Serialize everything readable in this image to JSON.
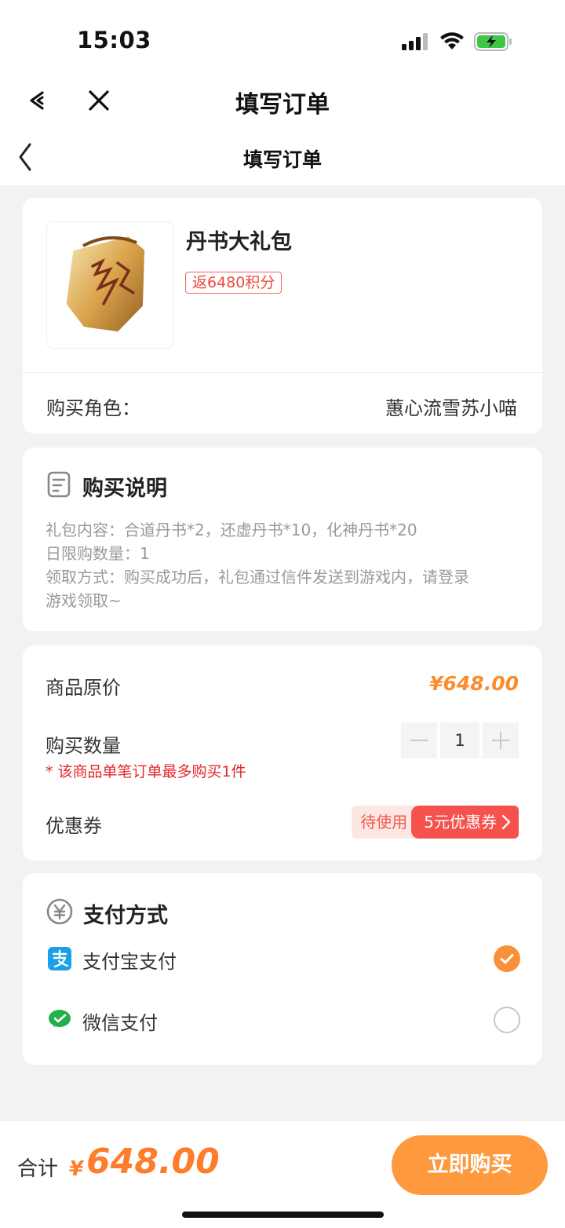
{
  "status_bar": {
    "time": "15:03"
  },
  "header_outer": {
    "title": "填写订单",
    "back_icon": "tiktok-back-icon",
    "close_icon": "close-icon"
  },
  "header_inner": {
    "title": "填写订单",
    "back_icon": "chevron-left-icon"
  },
  "product": {
    "name": "丹书大礼包",
    "points_tag": "返6480积分",
    "role_label": "购买角色：",
    "role_value": "蕙心流雪苏小喵"
  },
  "purchase_info": {
    "title": "购买说明",
    "lines": [
      "礼包内容：合道丹书*2，还虚丹书*10，化神丹书*20",
      "日限购数量：1",
      "领取方式：购买成功后，礼包通过信件发送到游戏内，请登录",
      "游戏领取~"
    ]
  },
  "order": {
    "price_label": "商品原价",
    "price_value": "¥648.00",
    "qty_label": "购买数量",
    "qty_value": "1",
    "qty_limit_note": "* 该商品单笔订单最多购买1件",
    "coupon_label": "优惠券",
    "coupon_status": "待使用",
    "coupon_name": "5元优惠券"
  },
  "payment": {
    "title": "支付方式",
    "methods": [
      {
        "label": "支付宝支付",
        "icon": "alipay-icon",
        "selected": true
      },
      {
        "label": "微信支付",
        "icon": "wechat-pay-icon",
        "selected": false
      }
    ]
  },
  "footer": {
    "total_label": "合计",
    "currency": "¥",
    "total_amount": "648.00",
    "buy_label": "立即购买"
  },
  "colors": {
    "accent": "#fe9a3d",
    "price": "#fc8b2c",
    "coupon": "#f6514c",
    "warning": "#e5272c"
  }
}
